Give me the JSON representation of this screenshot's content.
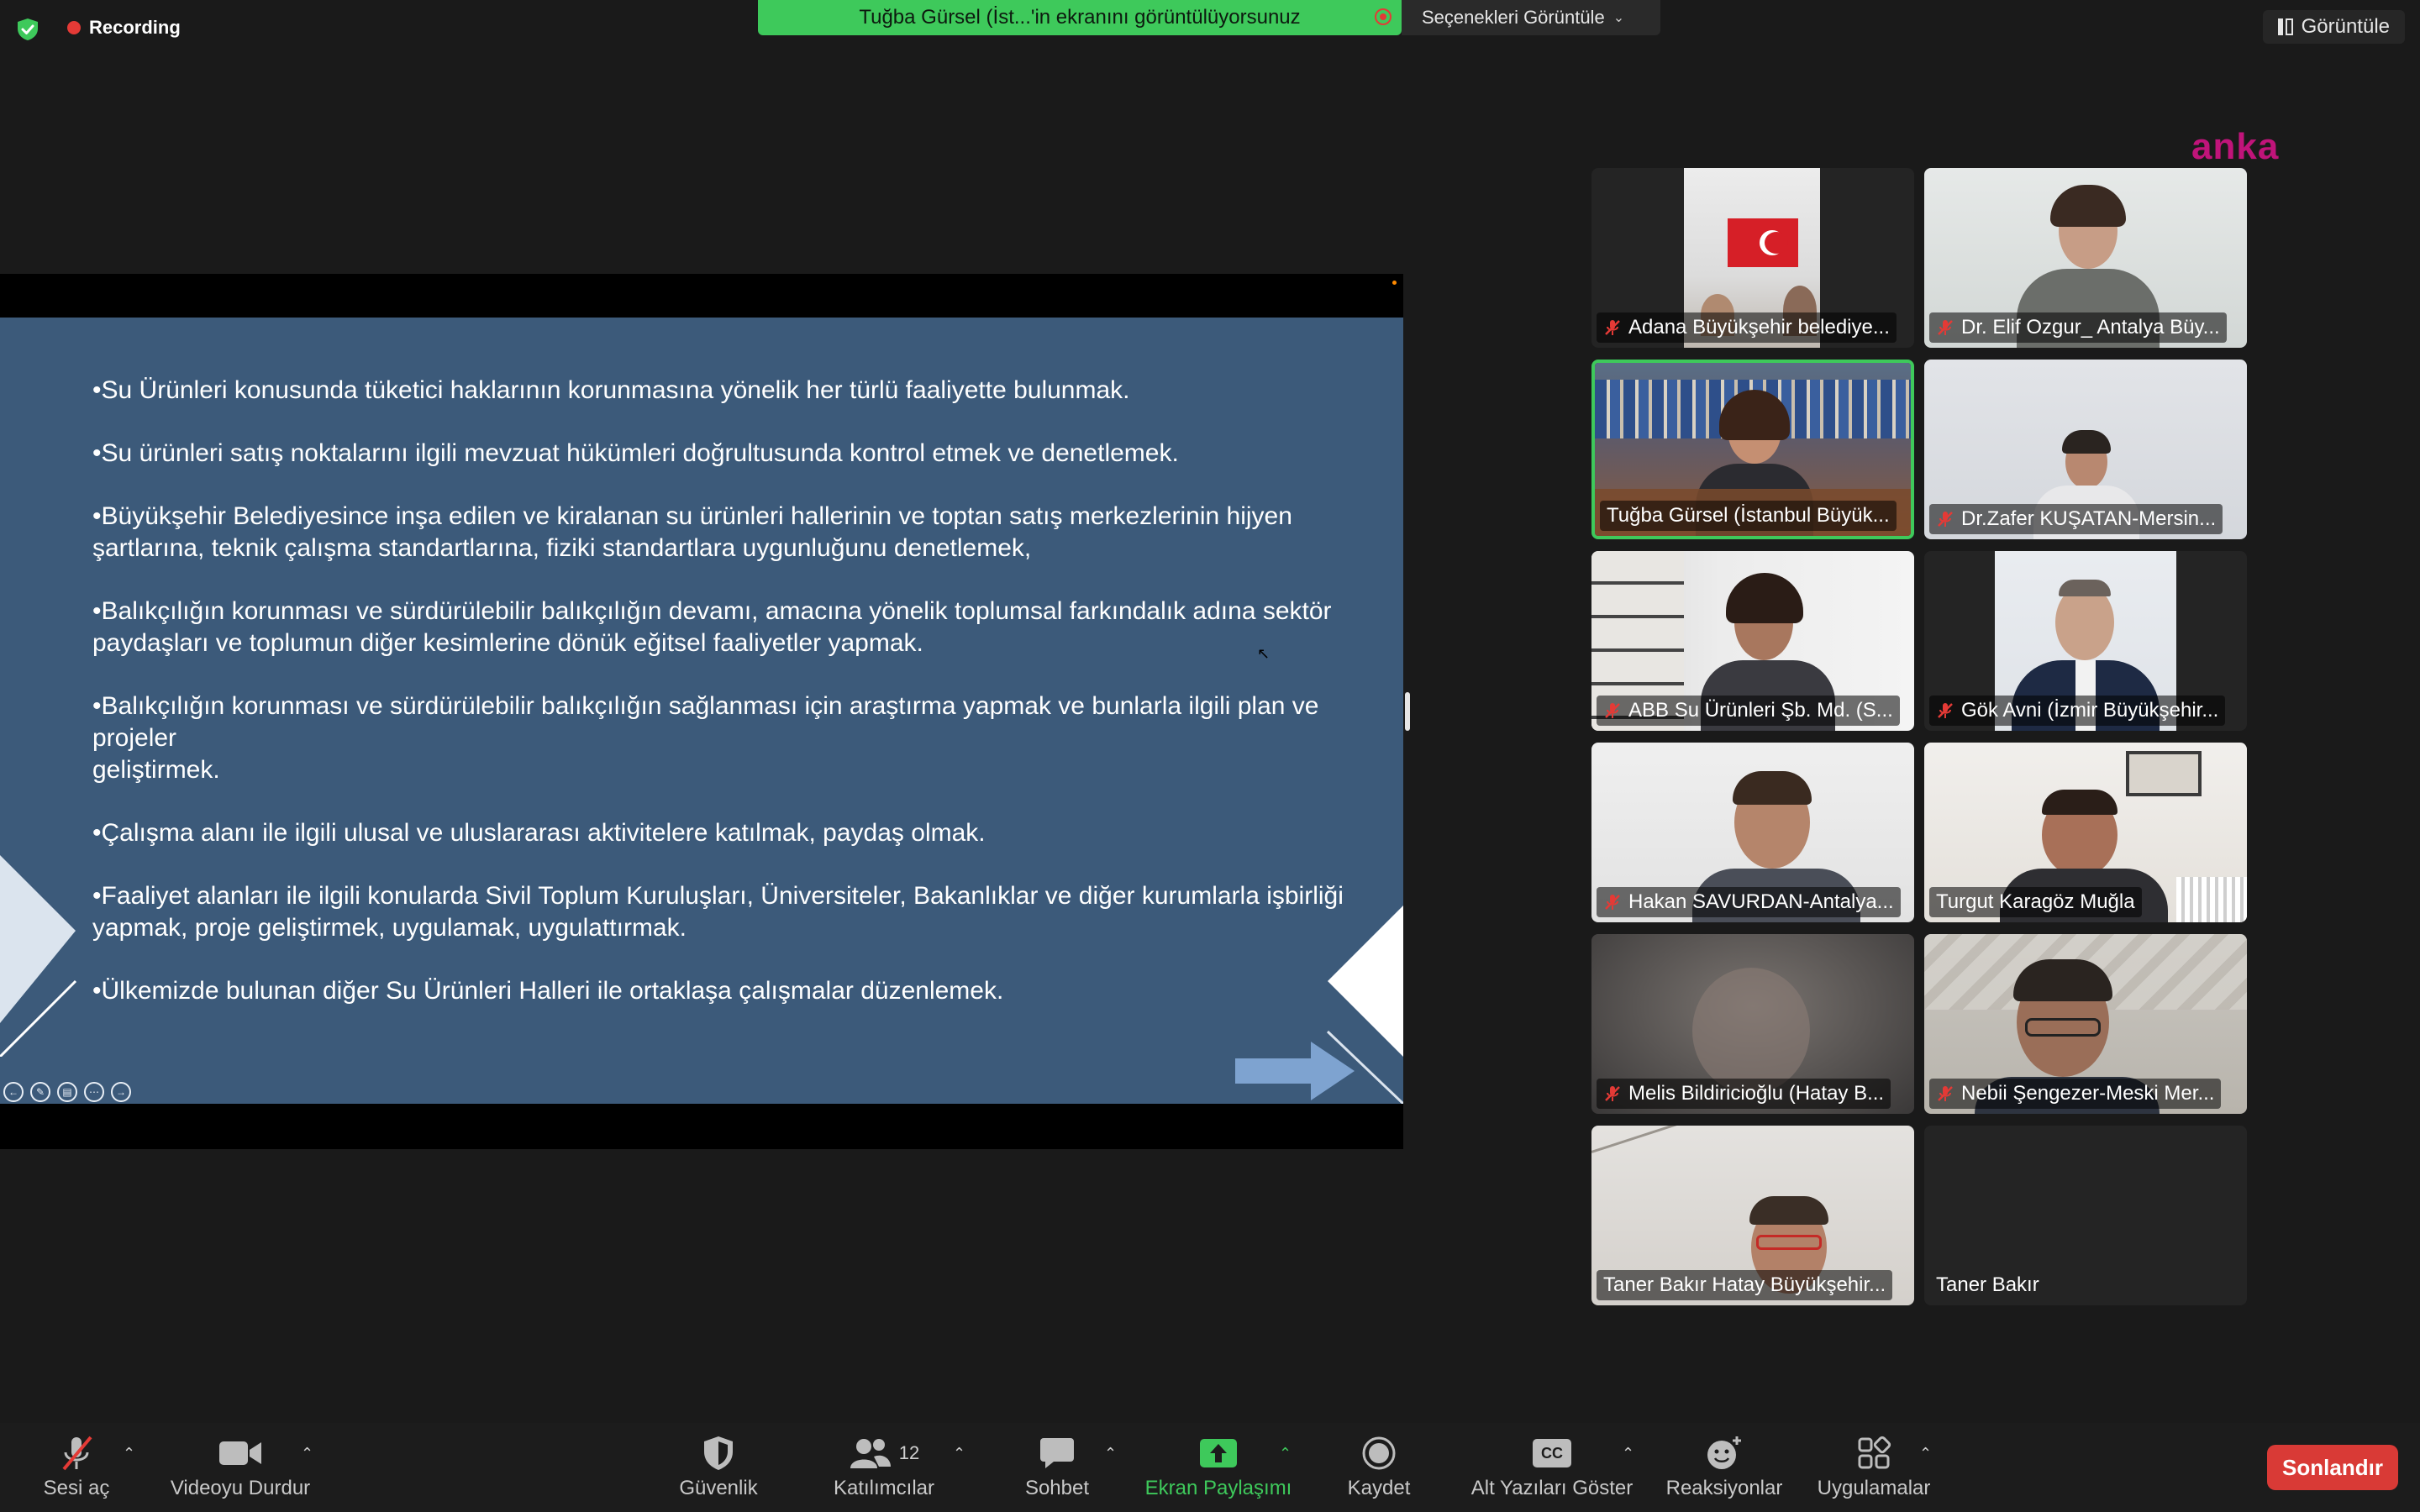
{
  "top": {
    "recording_label": "Recording",
    "share_banner": "Tuğba Gürsel (İst...'in ekranını görüntülüyorsunuz",
    "view_options": "Seçenekleri Görüntüle",
    "view_button": "Görüntüle",
    "watermark": "anka"
  },
  "slide": {
    "items": [
      "•Su Ürünleri konusunda tüketici haklarının korunmasına yönelik her türlü faaliyette bulunmak.",
      "•Su ürünleri satış noktalarını ilgili mevzuat hükümleri doğrultusunda kontrol etmek ve denetlemek.",
      "•Büyükşehir Belediyesince inşa edilen ve kiralanan su ürünleri hallerinin ve toptan satış merkezlerinin hijyen\nşartlarına, teknik çalışma standartlarına, fiziki standartlara uygunluğunu denetlemek,",
      "•Balıkçılığın korunması ve sürdürülebilir balıkçılığın devamı, amacına yönelik toplumsal farkındalık adına sektör\npaydaşları ve toplumun diğer kesimlerine dönük eğitsel faaliyetler yapmak.",
      "•Balıkçılığın korunması ve sürdürülebilir balıkçılığın sağlanması için araştırma yapmak ve bunlarla ilgili plan ve projeler\ngeliştirmek.",
      "•Çalışma alanı ile ilgili ulusal ve uluslararası aktivitelere katılmak, paydaş olmak.",
      "•Faaliyet alanları ile ilgili konularda Sivil Toplum Kuruluşları, Üniversiteler, Bakanlıklar ve diğer kurumlarla işbirliği\nyapmak, proje geliştirmek, uygulamak, uygulattırmak.",
      "•Ülkemizde bulunan diğer Su Ürünleri Halleri ile ortaklaşa çalışmalar düzenlemek."
    ],
    "background_color": "#3c5a7a"
  },
  "participants": [
    {
      "name": "Adana Büyükşehir belediye...",
      "muted": true,
      "active": false
    },
    {
      "name": "Dr. Elif Ozgur_ Antalya Büy...",
      "muted": true,
      "active": false
    },
    {
      "name": "Tuğba Gürsel (İstanbul Büyük...",
      "muted": false,
      "active": true
    },
    {
      "name": "Dr.Zafer KUŞATAN-Mersin...",
      "muted": true,
      "active": false
    },
    {
      "name": "ABB Su Ürünleri Şb. Md. (S...",
      "muted": true,
      "active": false
    },
    {
      "name": "Gök Avni (İzmir Büyükşehir...",
      "muted": true,
      "active": false
    },
    {
      "name": "Hakan SAVURDAN-Antalya...",
      "muted": true,
      "active": false
    },
    {
      "name": "Turgut Karagöz Muğla",
      "muted": false,
      "active": false
    },
    {
      "name": "Melis Bildiricioğlu (Hatay B...",
      "muted": true,
      "active": false
    },
    {
      "name": "Nebii Şengezer-Meski Mer...",
      "muted": true,
      "active": false
    },
    {
      "name": "Taner Bakır Hatay Büyükşehir...",
      "muted": false,
      "active": false
    },
    {
      "name": "Taner Bakır",
      "muted": false,
      "active": false
    }
  ],
  "toolbar": {
    "unmute": "Sesi aç",
    "stop_video": "Videoyu Durdur",
    "security": "Güvenlik",
    "participants": "Katılımcılar",
    "participants_count": "12",
    "chat": "Sohbet",
    "share_screen": "Ekran Paylaşımı",
    "record": "Kaydet",
    "captions": "Alt Yazıları Göster",
    "captions_badge": "CC",
    "reactions": "Reaksiyonlar",
    "apps": "Uygulamalar",
    "end": "Sonlandır"
  },
  "colors": {
    "share_green": "#3ec95b",
    "end_red": "#d93a36",
    "muted_red": "#e43a36",
    "watermark": "#c0147a"
  }
}
